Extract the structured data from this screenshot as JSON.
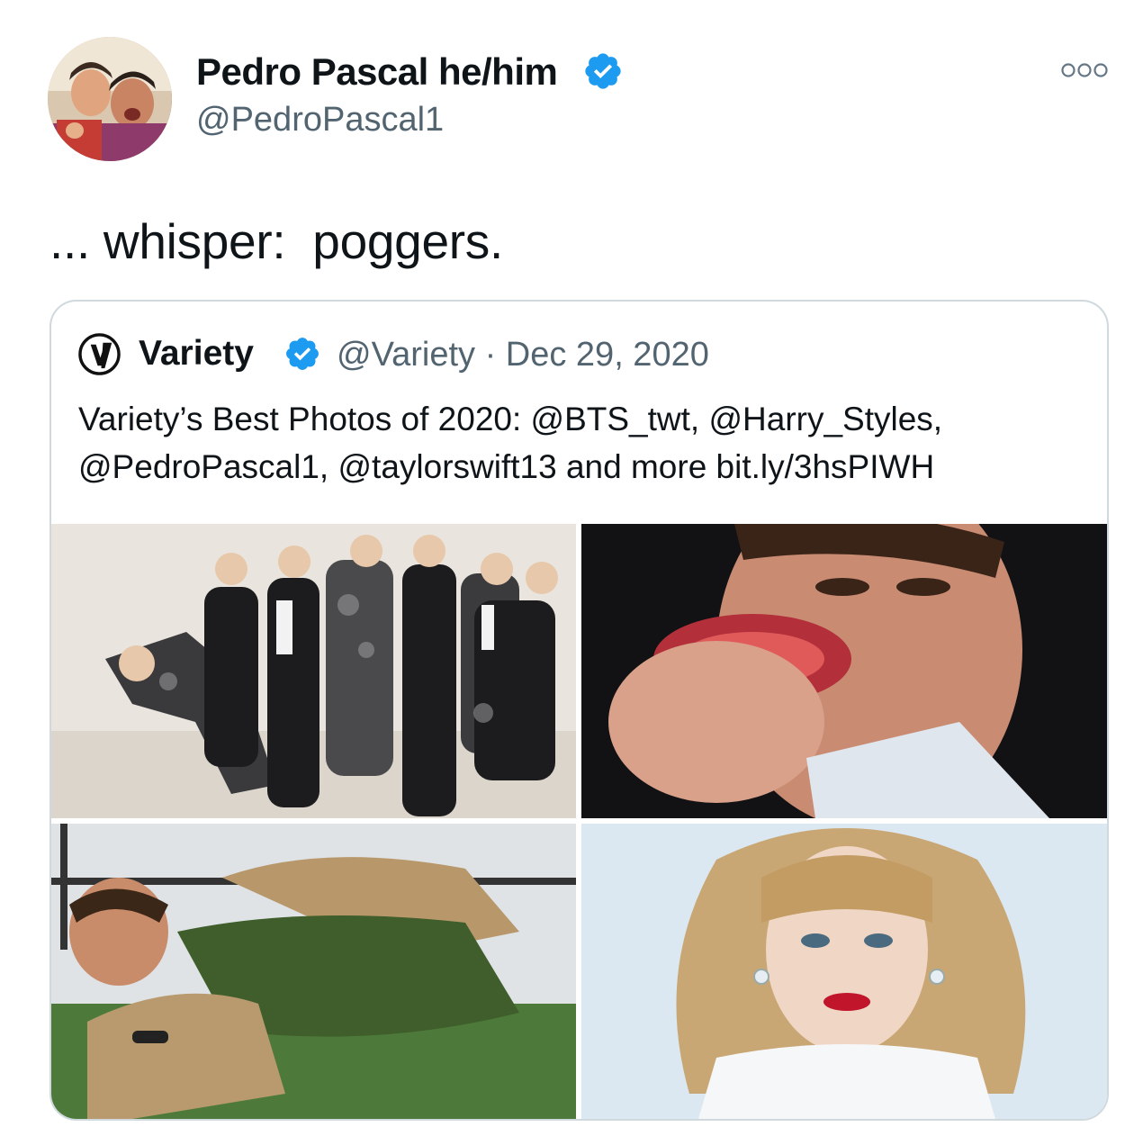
{
  "tweet": {
    "author_name": "Pedro Pascal he/him",
    "author_handle": "@PedroPascal1",
    "text": "... whisper:  poggers."
  },
  "quoted_tweet": {
    "author_name": "Variety",
    "handle_date": "@Variety · Dec 29, 2020",
    "text_lines": [
      "Variety’s Best Photos of 2020: @BTS_twt, @Harry_Styles,",
      "@PedroPascal1, @taylorswift13 and more bit.ly/3hsPIWH"
    ]
  },
  "colors": {
    "verified": "#1d9bf0",
    "border": "#cfd9de",
    "secondary_text": "#536471"
  },
  "icons": {
    "verified": "verified-badge-icon",
    "more": "more-options-icon",
    "variety_logo": "variety-logo-icon"
  }
}
